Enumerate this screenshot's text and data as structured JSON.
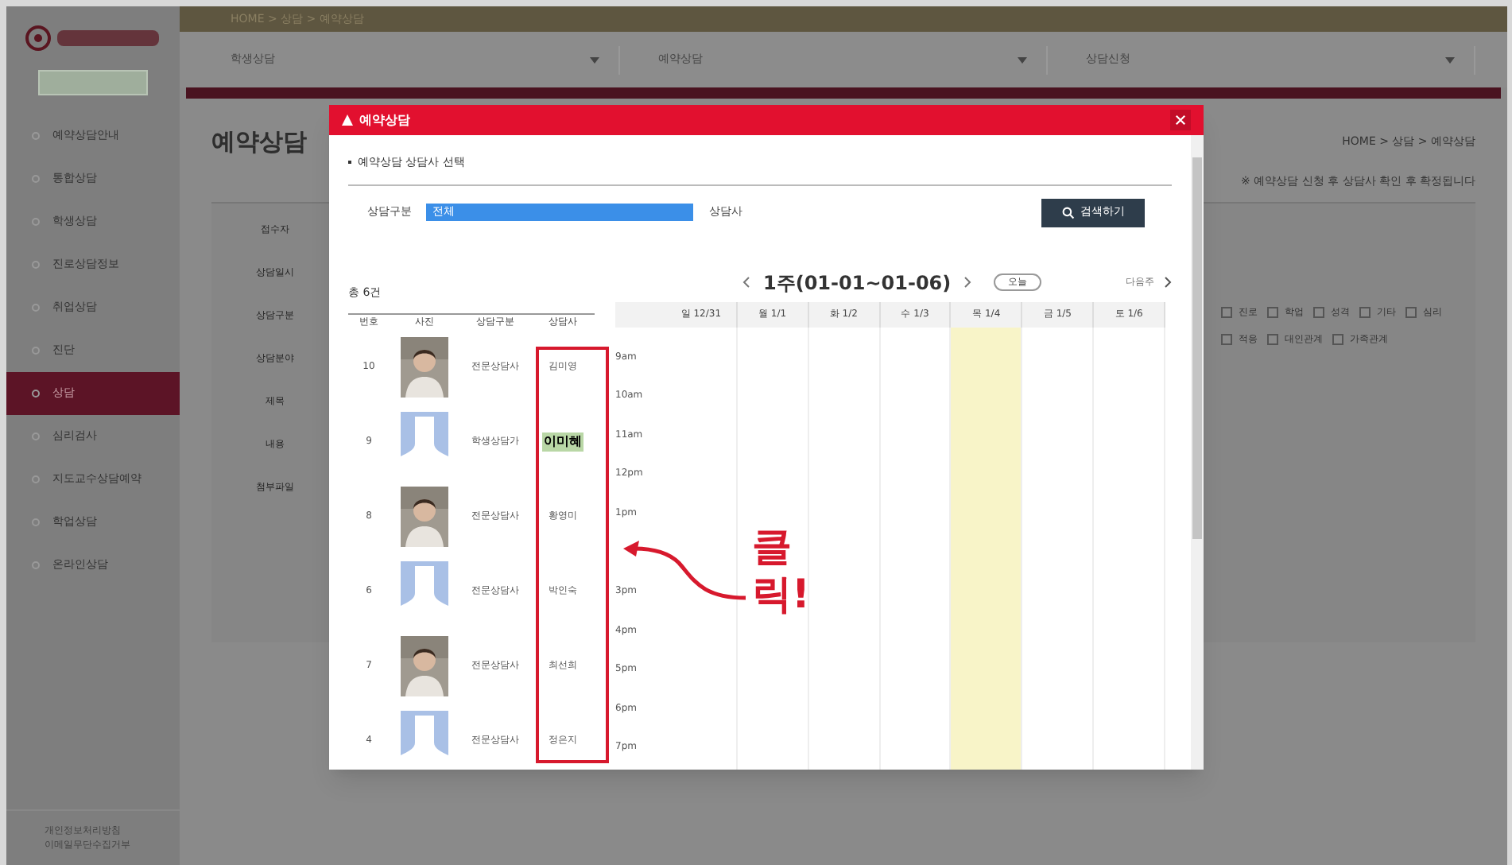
{
  "sidebar": {
    "items": [
      {
        "label": "예약상담안내",
        "selected": false
      },
      {
        "label": "통합상담",
        "selected": false
      },
      {
        "label": "학생상담",
        "selected": false
      },
      {
        "label": "진로상담정보",
        "selected": false
      },
      {
        "label": "취업상담",
        "selected": false
      },
      {
        "label": "진단",
        "selected": false
      },
      {
        "label": "상담",
        "selected": true
      },
      {
        "label": "심리검사",
        "selected": false
      },
      {
        "label": "지도교수상담예약",
        "selected": false
      },
      {
        "label": "학업상담",
        "selected": false
      },
      {
        "label": "온라인상담",
        "selected": false
      }
    ],
    "footer": [
      "개인정보처리방침",
      "이메일무단수집거부"
    ]
  },
  "topbar": {
    "breadcrumb": "HOME > 상담 > 예약상담"
  },
  "filters": [
    "학생상담",
    "예약상담",
    "상담신청"
  ],
  "page": {
    "title": "예약상담",
    "location": "HOME > 상담 > 예약상담",
    "notice": "※ 예약상담 신청 후 상담사 확인 후 확정됩니다",
    "form_labels": [
      "접수자",
      "상담일시",
      "상담구분",
      "상담분야",
      "제목",
      "내용",
      "첨부파일"
    ],
    "options": [
      {
        "label": "진로",
        "checked": false
      },
      {
        "label": "학업",
        "checked": false
      },
      {
        "label": "성격",
        "checked": false
      },
      {
        "label": "기타",
        "checked": false
      },
      {
        "label": "심리",
        "checked": false
      },
      {
        "label": "적응",
        "checked": false
      },
      {
        "label": "대인관계",
        "checked": false
      },
      {
        "label": "가족관계",
        "checked": false
      }
    ]
  },
  "modal": {
    "title": "예약상담",
    "section": "예약상담 상담사 선택",
    "filter_label": "상담구분",
    "filter_value": "전체",
    "counselor_label": "상담사",
    "search_button": "검색하기",
    "count": "총 6건",
    "columns": [
      "번호",
      "사진",
      "상담구분",
      "상담사"
    ],
    "counselors": [
      {
        "number": "10",
        "type": "전문상담사",
        "name": "김미영",
        "selected": false
      },
      {
        "number": "9",
        "kind": "placeholder",
        "type": "학생상담가",
        "name": "이미혜",
        "selected": true
      },
      {
        "number": "8",
        "type": "전문상담사",
        "name": "황영미",
        "selected": false
      },
      {
        "number": "6",
        "kind": "placeholder",
        "type": "전문상담사",
        "name": "박인숙",
        "selected": false
      },
      {
        "number": "7",
        "type": "전문상담사",
        "name": "최선희",
        "selected": false
      },
      {
        "number": "4",
        "kind": "placeholder",
        "type": "전문상담사",
        "name": "정은지",
        "selected": false
      }
    ],
    "week": "1주(01-01~01-06)",
    "today_button": "오늘",
    "next_label": "다음주",
    "days": [
      {
        "label": "일 12/31",
        "today": false
      },
      {
        "label": "월 1/1",
        "today": false
      },
      {
        "label": "화 1/2",
        "today": false
      },
      {
        "label": "수 1/3",
        "today": false
      },
      {
        "label": "목 1/4",
        "today": true
      },
      {
        "label": "금 1/5",
        "today": false
      },
      {
        "label": "토 1/6",
        "today": false
      }
    ],
    "times_above_arrow": [
      "9am",
      "10am",
      "11am",
      "12pm",
      "1pm"
    ],
    "times_below_arrow": [
      "3pm",
      "4pm",
      "5pm",
      "6pm",
      "7pm"
    ],
    "callout": "클릭!"
  }
}
